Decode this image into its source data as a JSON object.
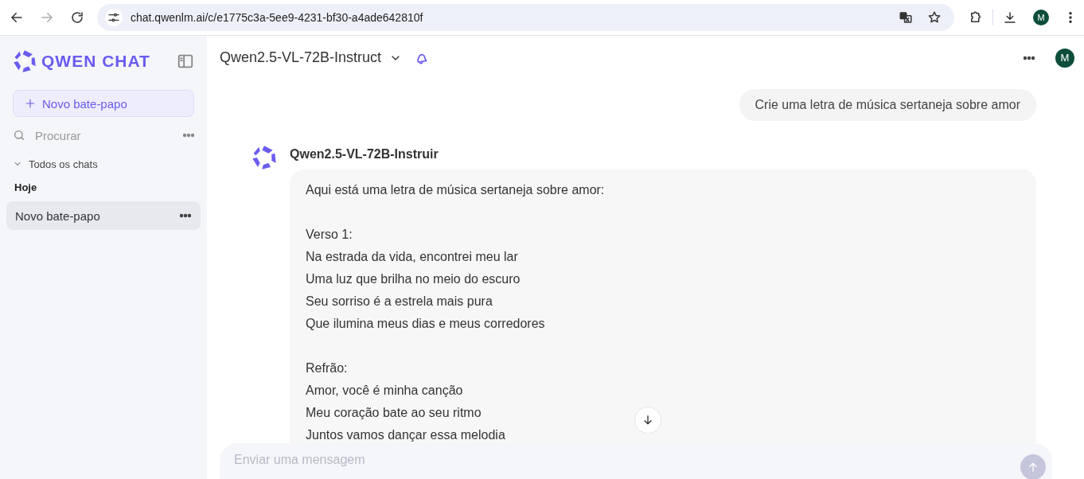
{
  "browser": {
    "url": "chat.qwenlm.ai/c/e1775c3a-5ee9-4231-bf30-a4ade642810f",
    "profile_initial": "M"
  },
  "sidebar": {
    "logo": "QWEN CHAT",
    "new_chat": "Novo bate-papo",
    "search": {
      "placeholder": "Procurar"
    },
    "section": {
      "label": "Todos os chats",
      "expanded": true
    },
    "groups": [
      {
        "label": "Hoje",
        "items": [
          {
            "title": "Novo bate-papo",
            "selected": true
          }
        ]
      }
    ]
  },
  "header": {
    "model": "Qwen2.5-VL-72B-Instruct",
    "avatar_initial": "M"
  },
  "messages": [
    {
      "kind": "user",
      "text": "Crie uma letra de música sertaneja sobre amor"
    },
    {
      "kind": "assistant",
      "name": "Qwen2.5-VL-72B-Instruir",
      "paragraphs": [
        [
          "Aqui está uma letra de música sertaneja sobre amor:"
        ],
        [
          "Verso 1:",
          "Na estrada da vida, encontrei meu lar",
          "Uma luz que brilha no meio do escuro",
          "Seu sorriso é a estrela mais pura",
          "Que ilumina meus dias e meus corredores"
        ],
        [
          "Refrão:",
          "Amor, você é minha canção",
          "Meu coração bate ao seu ritmo",
          "Juntos vamos dançar essa melodia"
        ]
      ]
    }
  ],
  "composer": {
    "placeholder": "Enviar uma mensagem"
  }
}
